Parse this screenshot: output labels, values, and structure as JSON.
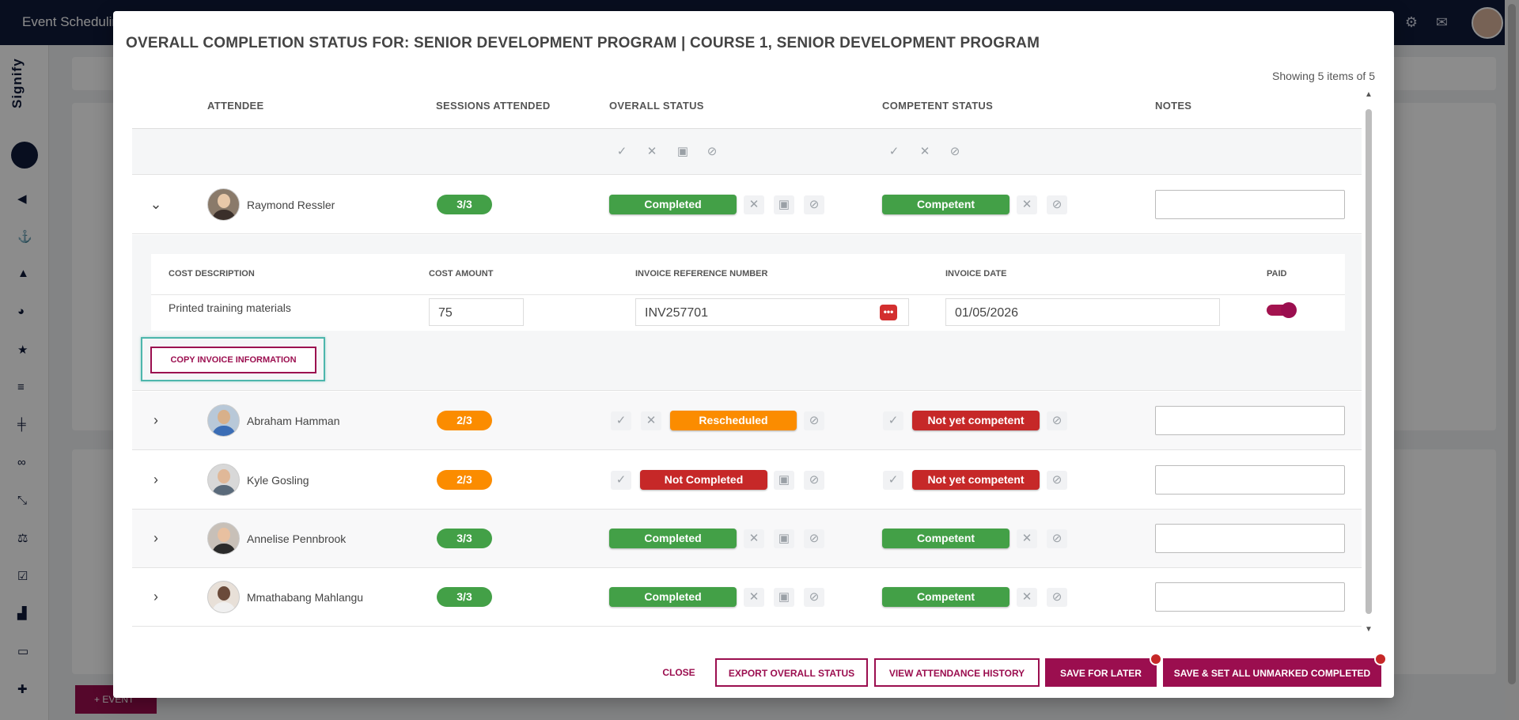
{
  "app": {
    "title": "Event Scheduling"
  },
  "background": {
    "event_button_label": "+ EVENT",
    "brand": "Signify"
  },
  "modal": {
    "title": "OVERALL COMPLETION STATUS FOR: SENIOR DEVELOPMENT PROGRAM | COURSE 1, SENIOR DEVELOPMENT PROGRAM",
    "showing": "Showing 5 items of 5",
    "columns": {
      "attendee": "ATTENDEE",
      "sessions": "SESSIONS ATTENDED",
      "overall": "OVERALL STATUS",
      "competent": "COMPETENT STATUS",
      "notes": "NOTES"
    },
    "attendees": [
      {
        "name": "Raymond Ressler",
        "sessions": "3/3",
        "overall": "Completed",
        "competent": "Competent"
      },
      {
        "name": "Abraham Hamman",
        "sessions": "2/3",
        "overall": "Rescheduled",
        "competent": "Not yet competent"
      },
      {
        "name": "Kyle Gosling",
        "sessions": "2/3",
        "overall": "Not Completed",
        "competent": "Not yet competent"
      },
      {
        "name": "Annelise Pennbrook",
        "sessions": "3/3",
        "overall": "Completed",
        "competent": "Competent"
      },
      {
        "name": "Mmathabang Mahlangu",
        "sessions": "3/3",
        "overall": "Completed",
        "competent": "Competent"
      }
    ],
    "cost": {
      "headers": {
        "description": "COST DESCRIPTION",
        "amount": "COST AMOUNT",
        "invoice_ref": "INVOICE REFERENCE NUMBER",
        "invoice_date": "INVOICE DATE",
        "paid": "PAID"
      },
      "row": {
        "description": "Printed training materials",
        "amount": "75",
        "invoice_ref": "INV257701",
        "invoice_date": "01/05/2026",
        "paid": true
      },
      "copy_button": "COPY INVOICE INFORMATION"
    },
    "footer": {
      "close": "CLOSE",
      "export": "EXPORT OVERALL STATUS",
      "history": "VIEW ATTENDANCE HISTORY",
      "save_later": "SAVE FOR LATER",
      "save_all": "SAVE & SET ALL UNMARKED COMPLETED"
    }
  },
  "colors": {
    "brand": "#9b0e4f",
    "green": "#43a047",
    "orange": "#fb8c00",
    "red": "#c62828",
    "navy": "#0f1a3a",
    "highlight": "#4db6ac"
  }
}
